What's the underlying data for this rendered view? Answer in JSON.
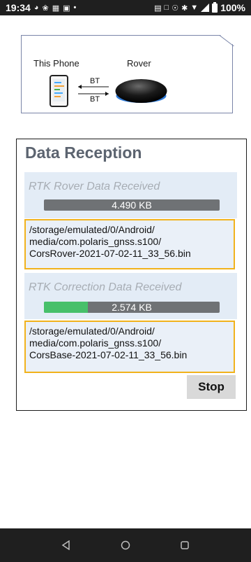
{
  "status_bar": {
    "time": "19:34",
    "battery": "100%",
    "left_icons": [
      "app-notification-icon",
      "pinwheel-icon",
      "grid-icon",
      "image-icon",
      "dot-icon"
    ],
    "right_icons": [
      "card-icon",
      "message-icon",
      "vibrate-icon",
      "bluetooth-icon",
      "wifi-icon",
      "signal-icon",
      "battery-icon"
    ]
  },
  "diagram": {
    "phone_label": "This Phone",
    "rover_label": "Rover",
    "link_top": "BT",
    "link_bottom": "BT"
  },
  "reception": {
    "title": "Data Reception",
    "rover": {
      "label": "RTK Rover Data Received",
      "amount": "4.490 KB",
      "progress": 0.0,
      "path_lines": [
        "/storage/emulated/0/Android/",
        "media/com.polaris_gnss.s100/",
        "CorsRover-2021-07-02-11_33_56.bin"
      ]
    },
    "correction": {
      "label": "RTK Correction Data Received",
      "amount": "2.574 KB",
      "progress": 0.25,
      "path_lines": [
        "/storage/emulated/0/Android/",
        "media/com.polaris_gnss.s100/",
        "CorsBase-2021-07-02-11_33_56.bin"
      ]
    },
    "stop_label": "Stop"
  },
  "colors": {
    "progress_fill": "#47c06a",
    "progress_track": "#6f7275",
    "path_border": "#f1b21c",
    "section_bg": "#e3ecf6"
  },
  "nav": [
    "back-icon",
    "home-icon",
    "recents-icon"
  ]
}
